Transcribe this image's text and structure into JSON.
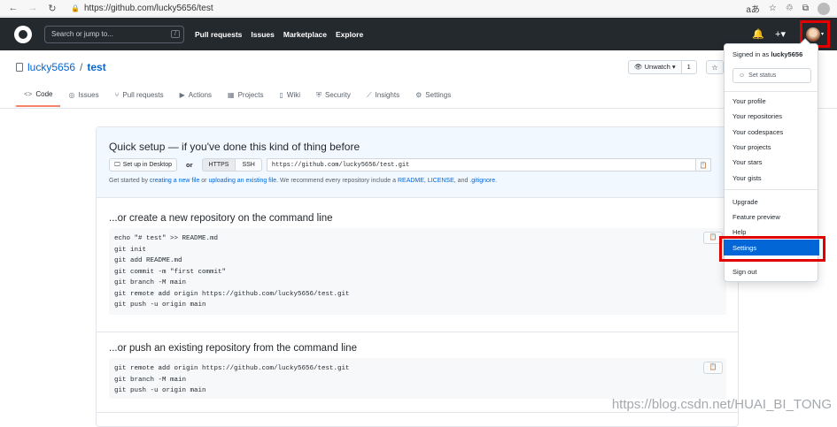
{
  "browser": {
    "url": "https://github.com/lucky5656/test",
    "right_labels": [
      "aあ",
      "☆",
      "♲",
      "⧉"
    ]
  },
  "header": {
    "search_placeholder": "Search or jump to...",
    "search_key": "/",
    "nav": [
      "Pull requests",
      "Issues",
      "Marketplace",
      "Explore"
    ],
    "plus": "+▾",
    "bell": "🔔"
  },
  "repo": {
    "owner": "lucky5656",
    "sep": "/",
    "name": "test",
    "watch_label": "Unwatch ▾",
    "watch_count": "1",
    "star": "☆",
    "tabs": [
      {
        "icon": "<>",
        "label": "Code"
      },
      {
        "icon": "◎",
        "label": "Issues"
      },
      {
        "icon": "⑂",
        "label": "Pull requests"
      },
      {
        "icon": "▶",
        "label": "Actions"
      },
      {
        "icon": "▦",
        "label": "Projects"
      },
      {
        "icon": "▯",
        "label": "Wiki"
      },
      {
        "icon": "⛨",
        "label": "Security"
      },
      {
        "icon": "⟋",
        "label": "Insights"
      },
      {
        "icon": "⚙",
        "label": "Settings"
      }
    ]
  },
  "quick_setup": {
    "title": "Quick setup — if you've done this kind of thing before",
    "desktop_label": "Set up in Desktop",
    "or": "or",
    "https": "HTTPS",
    "ssh": "SSH",
    "clone_url": "https://github.com/lucky5656/test.git",
    "hint": {
      "p1": "Get started by ",
      "l1": "creating a new file",
      "p2": " or ",
      "l2": "uploading an existing file",
      "p3": ". We recommend every repository include a ",
      "l3": "README",
      "p4": ", ",
      "l4": "LICENSE",
      "p5": ", and ",
      "l5": ".gitignore",
      "p6": "."
    }
  },
  "new_repo": {
    "title": "...or create a new repository on the command line",
    "lines": [
      "echo \"# test\" >> README.md",
      "git init",
      "git add README.md",
      "git commit -m \"first commit\"",
      "git branch -M main",
      "git remote add origin https://github.com/lucky5656/test.git",
      "git push -u origin main"
    ]
  },
  "push_existing": {
    "title": "...or push an existing repository from the command line",
    "lines": [
      "git remote add origin https://github.com/lucky5656/test.git",
      "git branch -M main",
      "git push -u origin main"
    ]
  },
  "menu": {
    "signed_prefix": "Signed in as ",
    "user": "lucky5656",
    "set_status": "Set status",
    "group1": [
      "Your profile",
      "Your repositories",
      "Your codespaces",
      "Your projects",
      "Your stars",
      "Your gists"
    ],
    "group2": [
      "Upgrade",
      "Feature preview",
      "Help"
    ],
    "settings": "Settings",
    "sign_out": "Sign out"
  },
  "watermark": "https://blog.csdn.net/HUAI_BI_TONG",
  "colors": {
    "highlight": "#e00000",
    "link": "#0366d6",
    "header_bg": "#24292e",
    "tab_accent": "#f9826c"
  }
}
